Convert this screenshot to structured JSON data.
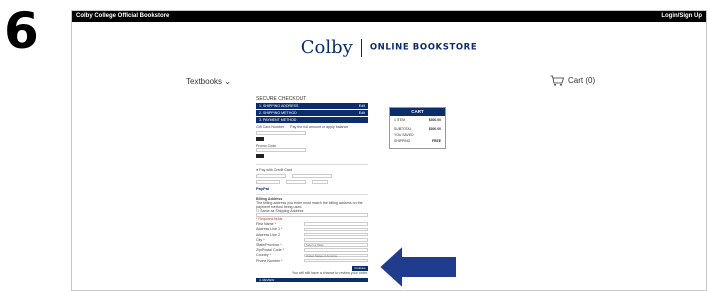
{
  "step_number": "6",
  "topbar": {
    "store_name": "Colby College Official Bookstore",
    "login": "Login/Sign Up"
  },
  "logo": {
    "name": "Colby",
    "tagline": "ONLINE BOOKSTORE"
  },
  "nav": {
    "textbooks": "Textbooks",
    "cart": "Cart (0)"
  },
  "checkout": {
    "title": "SECURE CHECKOUT",
    "steps": [
      {
        "label": "1. SHIPPING ADDRESS",
        "action": "Edit"
      },
      {
        "label": "2. SHIPPING METHOD",
        "action": "Edit"
      },
      {
        "label": "3. PAYMENT METHOD",
        "action": ""
      }
    ],
    "payment_text": "Gift Card Number",
    "payment_hint": "Pay the full amount or apply balance",
    "promo_label": "Promo Code",
    "card_option": "Pay with Credit Card",
    "paypal": "PayPal",
    "billing_title": "Billing Address",
    "billing_note": "The billing address you enter must match the billing address on the payment method being used.",
    "same_as_shipping": "Same as Shipping Address",
    "required_note": "* Required fields",
    "fields": [
      {
        "label": "First Name *",
        "value": ""
      },
      {
        "label": "Address Line 1 *",
        "value": ""
      },
      {
        "label": "Address Line 2",
        "value": ""
      },
      {
        "label": "City *",
        "value": ""
      },
      {
        "label": "State/Province *",
        "value": "Select a State"
      },
      {
        "label": "Zip/Postal Code *",
        "value": ""
      },
      {
        "label": "Country *",
        "value": "United States of America"
      },
      {
        "label": "Phone Number *",
        "value": ""
      }
    ],
    "continue_label": "Continue",
    "continue_note": "You will still have a chance to review your order.",
    "review_label": "4. REVIEW"
  },
  "cart_summary": {
    "title": "CART",
    "items_label": "1 ITEM",
    "items_value": "$300.00",
    "subtotal_label": "SUBTOTAL",
    "subtotal_value": "$300.00",
    "saved_label": "YOU SAVED",
    "shipping_label": "SHIPPING",
    "shipping_value": "FREE"
  },
  "colors": {
    "brand_navy": "#0b2d6b",
    "arrow_blue": "#1f3d8c"
  }
}
